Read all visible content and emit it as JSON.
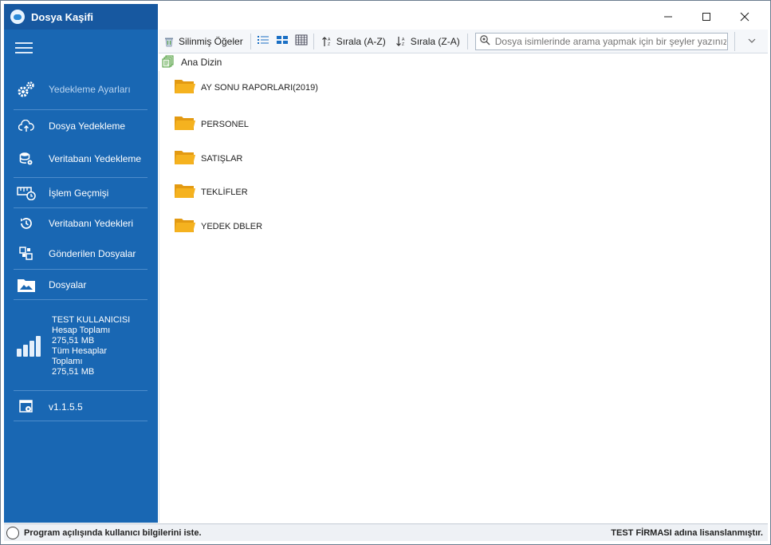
{
  "app": {
    "title": "Dosya Kaşifi",
    "window_controls": {
      "minimize": "—",
      "maximize": "☐",
      "close": "✕"
    }
  },
  "sidebar": {
    "items": [
      {
        "label": "Yedekleme Ayarları",
        "icon": "gears-icon"
      },
      {
        "label": "Dosya Yedekleme",
        "icon": "cloud-upload-icon"
      },
      {
        "label": "Veritabanı Yedekleme",
        "icon": "database-settings-icon"
      },
      {
        "label": "İşlem Geçmişi",
        "icon": "history-ruler-icon"
      },
      {
        "label": "Veritabanı Yedekleri",
        "icon": "restore-clock-icon"
      },
      {
        "label": "Gönderilen Dosyalar",
        "icon": "sent-files-icon"
      },
      {
        "label": "Dosyalar",
        "icon": "folder-image-icon"
      }
    ],
    "stats": {
      "user": "TEST KULLANICISI",
      "account_total_label": "Hesap Toplamı",
      "account_total_value": "275,51 MB",
      "all_accounts_label_1": "Tüm Hesaplar",
      "all_accounts_label_2": "Toplamı",
      "all_accounts_value": "275,51 MB"
    },
    "version": "v1.1.5.5"
  },
  "toolbar": {
    "deleted_items": "Silinmiş Öğeler",
    "sort_az": "Sırala (A-Z)",
    "sort_za": "Sırala (Z-A)",
    "search_placeholder": "Dosya isimlerinde arama yapmak için bir şeyler yazınız."
  },
  "breadcrumb": {
    "root": "Ana Dizin"
  },
  "folders": [
    "AY SONU RAPORLARI(2019)",
    "PERSONEL",
    "SATIŞLAR",
    "TEKLİFLER",
    "YEDEK DBLER"
  ],
  "status": {
    "checkbox_label": "Program açılışında kullanıcı bilgilerini iste.",
    "license": "TEST FİRMASI adına lisanslanmıştır."
  },
  "colors": {
    "sidebar": "#1967b3",
    "folder": "#f5b21f",
    "accent": "#1a6fc4"
  }
}
